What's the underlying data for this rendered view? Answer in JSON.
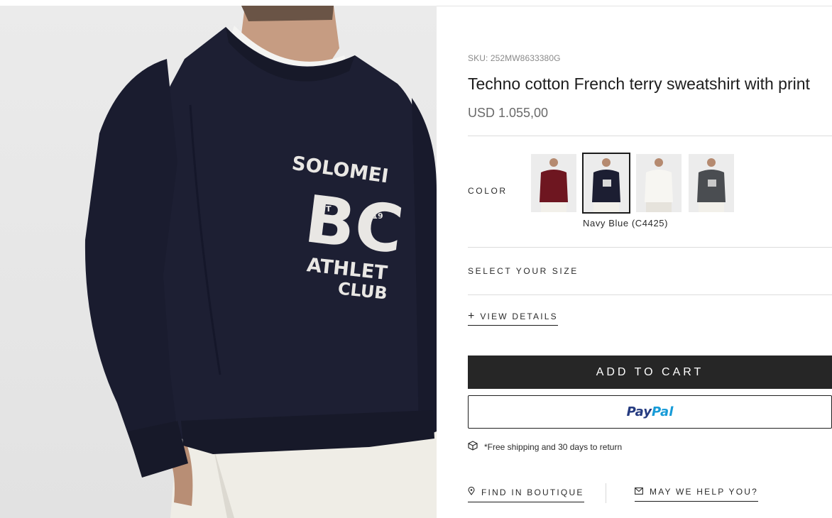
{
  "product": {
    "sku": "SKU: 252MW8633380G",
    "title": "Techno cotton French terry sweatshirt with print",
    "price": "USD 1.055,00",
    "print_lines": [
      "SOLOMEI",
      "BC",
      "EST",
      "19",
      "ATHLET",
      "CLUB"
    ]
  },
  "color": {
    "label": "COLOR",
    "selected_name": "Navy Blue (C4425)",
    "swatches": [
      {
        "name": "burgundy",
        "hex": "#6e1620",
        "selected": false
      },
      {
        "name": "navy",
        "hex": "#1c1e32",
        "selected": true
      },
      {
        "name": "white",
        "hex": "#f1efe9",
        "selected": false
      },
      {
        "name": "grey",
        "hex": "#4a4d51",
        "selected": false
      }
    ]
  },
  "size": {
    "label": "SELECT YOUR SIZE"
  },
  "details": {
    "plus": "+",
    "label": "VIEW DETAILS"
  },
  "actions": {
    "add_to_cart": "ADD TO CART",
    "paypal_a": "Pay",
    "paypal_b": "Pal"
  },
  "shipping": {
    "text": "*Free shipping and 30 days to return",
    "icon": "box-icon"
  },
  "links": {
    "boutique": "FIND IN BOUTIQUE",
    "help": "MAY WE HELP YOU?"
  },
  "colors": {
    "sweater": "#1c1e32",
    "button_dark": "#262626",
    "paypal_dark": "#253b80",
    "paypal_light": "#179bd7"
  }
}
